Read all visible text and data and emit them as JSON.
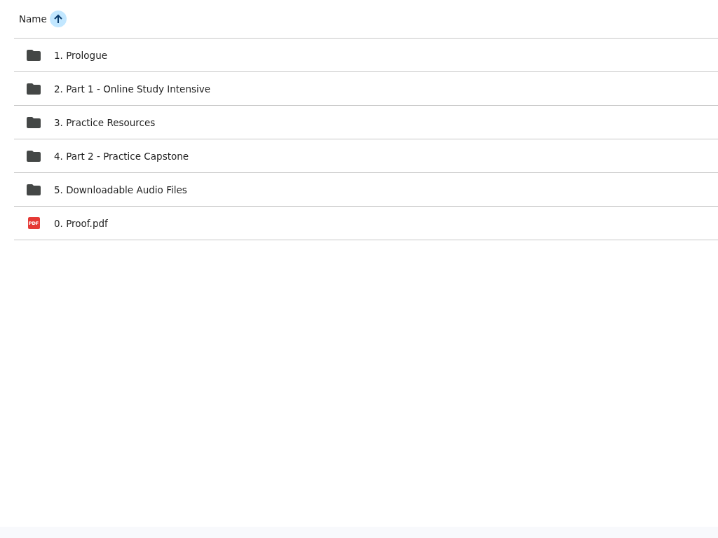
{
  "header": {
    "label": "Name",
    "sort_ascending": true
  },
  "items": [
    {
      "kind": "folder",
      "name": "1. Prologue"
    },
    {
      "kind": "folder",
      "name": "2. Part 1 - Online Study Intensive"
    },
    {
      "kind": "folder",
      "name": "3. Practice Resources"
    },
    {
      "kind": "folder",
      "name": "4. Part 2 - Practice Capstone"
    },
    {
      "kind": "folder",
      "name": "5. Downloadable Audio Files"
    },
    {
      "kind": "pdf",
      "name": "0. Proof.pdf",
      "badge": "PDF"
    }
  ]
}
